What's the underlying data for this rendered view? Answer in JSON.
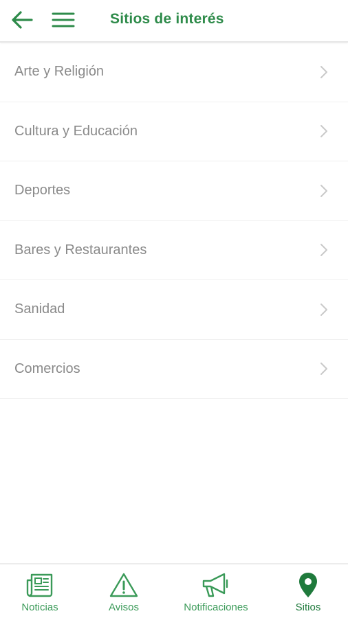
{
  "header": {
    "title": "Sitios de interés",
    "back_icon": "arrow-left-icon",
    "menu_icon": "hamburger-menu-icon"
  },
  "colors": {
    "accent": "#2e8b4a",
    "item_text": "#8a8a8a",
    "chevron": "#c9c9c9"
  },
  "list": {
    "items": [
      {
        "label": "Arte y Religión"
      },
      {
        "label": "Cultura y Educación"
      },
      {
        "label": "Deportes"
      },
      {
        "label": "Bares y Restaurantes"
      },
      {
        "label": "Sanidad"
      },
      {
        "label": "Comercios"
      }
    ]
  },
  "tabbar": {
    "tabs": [
      {
        "label": "Noticias",
        "icon": "newspaper-icon"
      },
      {
        "label": "Avisos",
        "icon": "warning-triangle-icon"
      },
      {
        "label": "Notificaciones",
        "icon": "megaphone-icon"
      },
      {
        "label": "Sitios",
        "icon": "map-pin-icon",
        "active": true
      }
    ]
  }
}
